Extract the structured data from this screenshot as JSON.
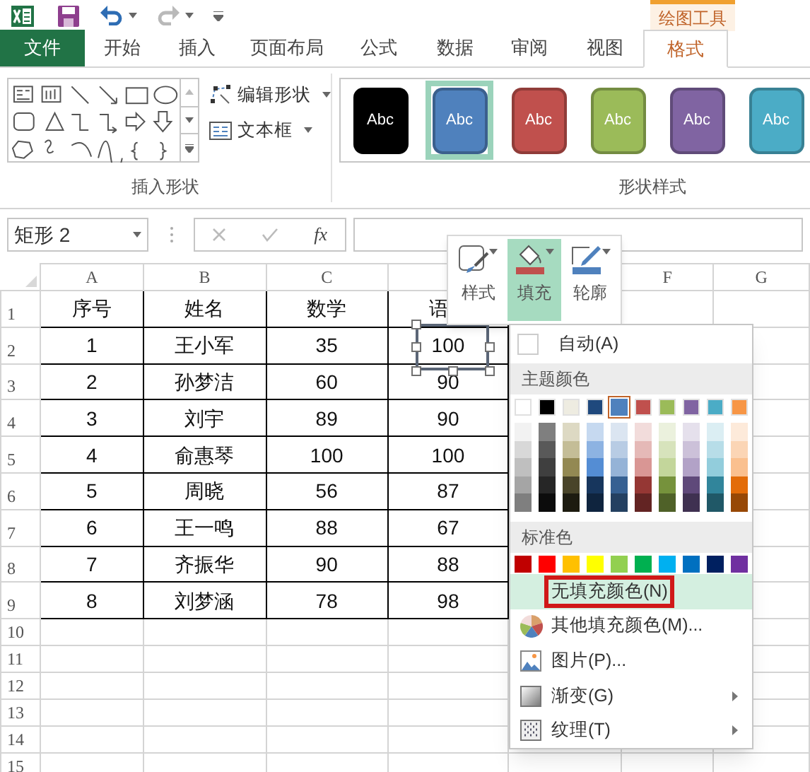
{
  "contextual_tab_group": {
    "label": "绘图工具"
  },
  "ribbon_tabs": [
    {
      "label": "文件",
      "kind": "file",
      "selected": false
    },
    {
      "label": "开始",
      "kind": "tab",
      "selected": false
    },
    {
      "label": "插入",
      "kind": "tab",
      "selected": false
    },
    {
      "label": "页面布局",
      "kind": "tab",
      "selected": false
    },
    {
      "label": "公式",
      "kind": "tab",
      "selected": false
    },
    {
      "label": "数据",
      "kind": "tab",
      "selected": false
    },
    {
      "label": "审阅",
      "kind": "tab",
      "selected": false
    },
    {
      "label": "视图",
      "kind": "tab",
      "selected": false
    },
    {
      "label": "格式",
      "kind": "tab",
      "selected": true
    }
  ],
  "insert_shapes_group": {
    "label": "插入形状",
    "commands": [
      {
        "label": "编辑形状",
        "kind": "edit-shape"
      },
      {
        "label": "文本框",
        "kind": "text-box"
      }
    ]
  },
  "shape_styles_group": {
    "label": "形状样式",
    "presets": [
      {
        "label": "Abc",
        "color": "#000000",
        "selected": false
      },
      {
        "label": "Abc",
        "color": "#4f81bd",
        "selected": true
      },
      {
        "label": "Abc",
        "color": "#c0504d",
        "selected": false
      },
      {
        "label": "Abc",
        "color": "#9bbb59",
        "selected": false
      },
      {
        "label": "Abc",
        "color": "#8064a2",
        "selected": false
      },
      {
        "label": "Abc",
        "color": "#4bacc6",
        "selected": false
      }
    ]
  },
  "name_box": "矩形 2",
  "formula_bar": {
    "insert_function": "fx"
  },
  "grid": {
    "column_headers_left": [
      "A",
      "B",
      "C"
    ],
    "column_headers_right": [
      "F",
      "G"
    ],
    "rows": [
      {
        "number": "1",
        "cells": [
          "序号",
          "姓名",
          "数学",
          "语"
        ]
      },
      {
        "number": "2",
        "cells": [
          "1",
          "王小军",
          "35",
          "100"
        ]
      },
      {
        "number": "3",
        "cells": [
          "2",
          "孙梦洁",
          "60",
          "90"
        ]
      },
      {
        "number": "4",
        "cells": [
          "3",
          "刘宇",
          "89",
          "90"
        ]
      },
      {
        "number": "5",
        "cells": [
          "4",
          "俞惠琴",
          "100",
          "100"
        ]
      },
      {
        "number": "6",
        "cells": [
          "5",
          "周晓",
          "56",
          "87"
        ]
      },
      {
        "number": "7",
        "cells": [
          "6",
          "王一鸣",
          "88",
          "67"
        ]
      },
      {
        "number": "8",
        "cells": [
          "7",
          "齐振华",
          "90",
          "88"
        ]
      },
      {
        "number": "9",
        "cells": [
          "8",
          "刘梦涵",
          "78",
          "98"
        ]
      },
      {
        "number": "10"
      },
      {
        "number": "11"
      },
      {
        "number": "12"
      },
      {
        "number": "13"
      },
      {
        "number": "14"
      },
      {
        "number": "15"
      }
    ]
  },
  "mini_toolbar": {
    "buttons": [
      {
        "label": "样式",
        "kind": "style",
        "selected": false
      },
      {
        "label": "填充",
        "kind": "fill",
        "selected": true
      },
      {
        "label": "轮廓",
        "kind": "outline",
        "selected": false
      }
    ]
  },
  "fill_menu": {
    "automatic": "自动(A)",
    "theme_header": "主题颜色",
    "theme_colors": [
      {
        "color": "#ffffff",
        "selected": false,
        "shades": [
          {
            "color": "#f2f2f2"
          },
          {
            "color": "#d8d8d8"
          },
          {
            "color": "#bfbfbf"
          },
          {
            "color": "#a5a5a5"
          },
          {
            "color": "#7f7f7f"
          }
        ]
      },
      {
        "color": "#000000",
        "selected": false,
        "shades": [
          {
            "color": "#7f7f7f"
          },
          {
            "color": "#595959"
          },
          {
            "color": "#3f3f3f"
          },
          {
            "color": "#262626"
          },
          {
            "color": "#0c0c0c"
          }
        ]
      },
      {
        "color": "#eeece1",
        "selected": false,
        "shades": [
          {
            "color": "#ddd9c3"
          },
          {
            "color": "#c4bd97"
          },
          {
            "color": "#938953"
          },
          {
            "color": "#494429"
          },
          {
            "color": "#1d1b10"
          }
        ]
      },
      {
        "color": "#1f497d",
        "selected": false,
        "shades": [
          {
            "color": "#c6d9f0"
          },
          {
            "color": "#8db3e2"
          },
          {
            "color": "#548dd4"
          },
          {
            "color": "#17365d"
          },
          {
            "color": "#0f243e"
          }
        ]
      },
      {
        "color": "#4f81bd",
        "selected": true,
        "shades": [
          {
            "color": "#dbe5f1"
          },
          {
            "color": "#b8cce4"
          },
          {
            "color": "#95b3d7"
          },
          {
            "color": "#366092"
          },
          {
            "color": "#244061"
          }
        ]
      },
      {
        "color": "#c0504d",
        "selected": false,
        "shades": [
          {
            "color": "#f2dcdb"
          },
          {
            "color": "#e5b9b7"
          },
          {
            "color": "#d99694"
          },
          {
            "color": "#953734"
          },
          {
            "color": "#632423"
          }
        ]
      },
      {
        "color": "#9bbb59",
        "selected": false,
        "shades": [
          {
            "color": "#ebf1dd"
          },
          {
            "color": "#d7e3bc"
          },
          {
            "color": "#c3d69b"
          },
          {
            "color": "#76923c"
          },
          {
            "color": "#4f6128"
          }
        ]
      },
      {
        "color": "#8064a2",
        "selected": false,
        "shades": [
          {
            "color": "#e5e0ec"
          },
          {
            "color": "#ccc1d9"
          },
          {
            "color": "#b2a2c7"
          },
          {
            "color": "#5f497a"
          },
          {
            "color": "#3f3151"
          }
        ]
      },
      {
        "color": "#4bacc6",
        "selected": false,
        "shades": [
          {
            "color": "#dbeef3"
          },
          {
            "color": "#b7dde8"
          },
          {
            "color": "#92cddc"
          },
          {
            "color": "#31859b"
          },
          {
            "color": "#205867"
          }
        ]
      },
      {
        "color": "#f79646",
        "selected": false,
        "shades": [
          {
            "color": "#fdeada"
          },
          {
            "color": "#fbd5b5"
          },
          {
            "color": "#fac08f"
          },
          {
            "color": "#e36c09"
          },
          {
            "color": "#974806"
          }
        ]
      }
    ],
    "standard_header": "标准色",
    "standard_colors": [
      {
        "color": "#c00000"
      },
      {
        "color": "#ff0000"
      },
      {
        "color": "#ffc000"
      },
      {
        "color": "#ffff00"
      },
      {
        "color": "#92d050"
      },
      {
        "color": "#00b050"
      },
      {
        "color": "#00b0f0"
      },
      {
        "color": "#0070c0"
      },
      {
        "color": "#002060"
      },
      {
        "color": "#7030a0"
      }
    ],
    "items": [
      {
        "label": "无填充颜色(N)",
        "kind": "no-fill",
        "selected": true,
        "marked": true,
        "submenu": false
      },
      {
        "label": "其他填充颜色(M)...",
        "kind": "more-colors",
        "selected": false,
        "marked": false,
        "submenu": false
      },
      {
        "label": "图片(P)...",
        "kind": "picture",
        "selected": false,
        "marked": false,
        "submenu": false
      },
      {
        "label": "渐变(G)",
        "kind": "gradient",
        "selected": false,
        "marked": false,
        "submenu": true
      },
      {
        "label": "纹理(T)",
        "kind": "texture",
        "selected": false,
        "marked": false,
        "submenu": true
      }
    ]
  }
}
